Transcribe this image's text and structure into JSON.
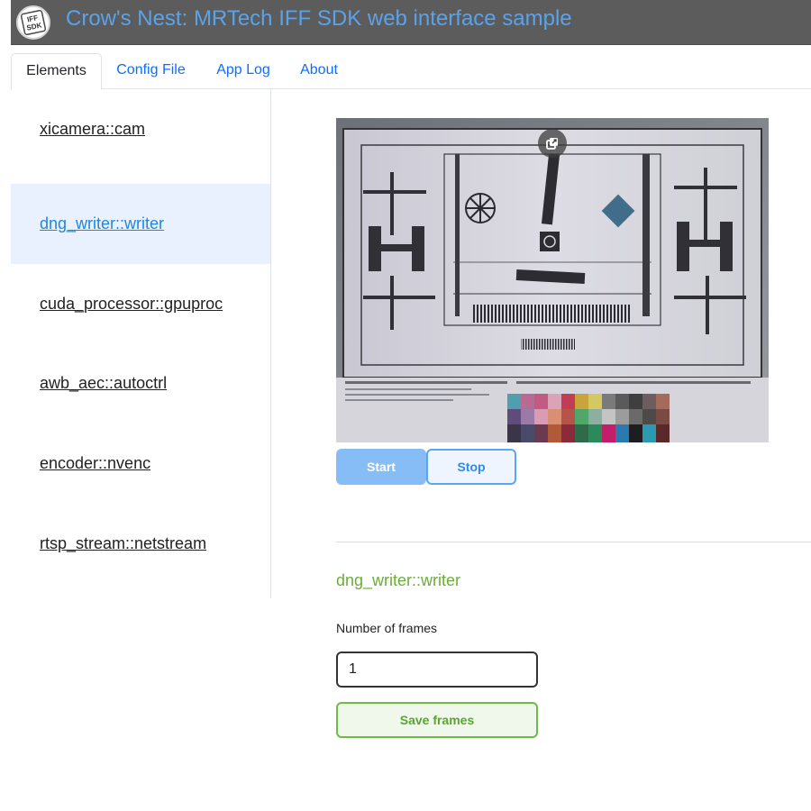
{
  "header": {
    "title": "Crow's Nest: MRTech IFF SDK web interface sample",
    "logo_text_top": "IFF",
    "logo_text_bottom": "SDK"
  },
  "tabs": [
    {
      "label": "Elements",
      "active": true
    },
    {
      "label": "Config File",
      "active": false
    },
    {
      "label": "App Log",
      "active": false
    },
    {
      "label": "About",
      "active": false
    }
  ],
  "sidebar": {
    "items": [
      {
        "label": "xicamera::cam",
        "active": false
      },
      {
        "label": "dng_writer::writer",
        "active": true
      },
      {
        "label": "cuda_processor::gpuproc",
        "active": false
      },
      {
        "label": "awb_aec::autoctrl",
        "active": false
      },
      {
        "label": "encoder::nvenc",
        "active": false
      },
      {
        "label": "rtsp_stream::netstream",
        "active": false
      }
    ]
  },
  "preview": {
    "icon": "popout-icon"
  },
  "controls": {
    "start_label": "Start",
    "stop_label": "Stop"
  },
  "element_panel": {
    "title": "dng_writer::writer",
    "frames_label": "Number of frames",
    "frames_value": "1",
    "save_label": "Save frames"
  },
  "colors": {
    "header_bg": "#5c5c5c",
    "title_blue": "#5aa2ea",
    "accent_green": "#6aae3a",
    "sidebar_active_bg": "#e8f1fd"
  }
}
